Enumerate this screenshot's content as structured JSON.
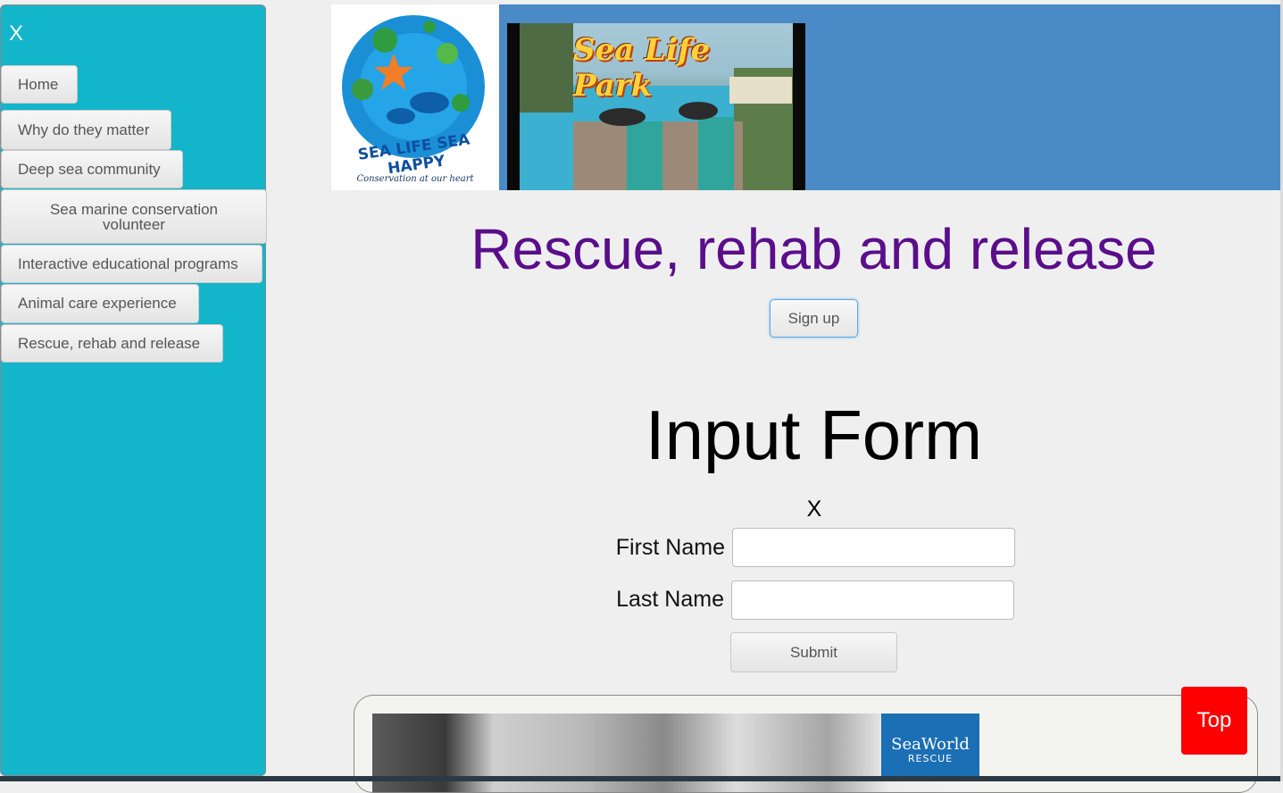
{
  "sidebar": {
    "close_label": "X",
    "items": [
      {
        "label": "Home"
      },
      {
        "label": "Why do they matter"
      },
      {
        "label": "Deep sea community"
      },
      {
        "label": "Sea marine conservation volunteer"
      },
      {
        "label": "Interactive educational programs"
      },
      {
        "label": "Animal care experience"
      },
      {
        "label": "Rescue, rehab and release"
      }
    ]
  },
  "header": {
    "logo_text_top": "SEA LIFE SEA HAPPY",
    "logo_tagline": "Conservation at our heart",
    "park_title": "Sea Life Park"
  },
  "main": {
    "headline": "Rescue, rehab and release",
    "signup_label": "Sign up",
    "form": {
      "title": "Input Form",
      "close_label": "X",
      "first_name_label": "First Name",
      "first_name_value": "",
      "last_name_label": "Last Name",
      "last_name_value": "",
      "submit_label": "Submit"
    },
    "card": {
      "brand": "SeaWorld",
      "brand_sub": "RESCUE"
    },
    "top_button_label": "Top"
  },
  "colors": {
    "sidebar_bg": "#12b5ca",
    "header_bg": "#4a8ac7",
    "headline": "#5a0e8a",
    "top_button": "#ff0000"
  }
}
